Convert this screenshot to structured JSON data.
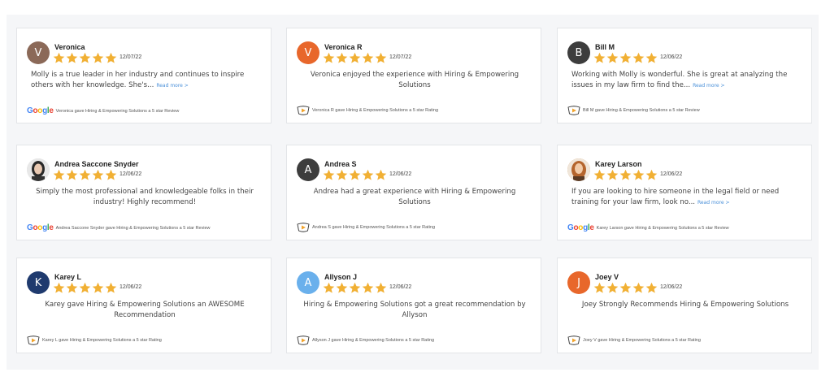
{
  "colors": {
    "star": "#f1b034",
    "link": "#4a90d9"
  },
  "reviews": [
    {
      "name": "Veronica",
      "date": "12/07/22",
      "initial": "V",
      "avatar_color": "#8b6958",
      "avatar_type": "initial",
      "text": "Molly is a true leader in her industry and continues to inspire others with her knowledge. She's...",
      "read_more": "Read more >",
      "centered": false,
      "source": "google",
      "footer": "Veronica gave Hiring & Empowering Solutions a 5 star Review",
      "stars": 5
    },
    {
      "name": "Veronica R",
      "date": "12/07/22",
      "initial": "V",
      "avatar_color": "#e8672b",
      "avatar_type": "initial",
      "text": "Veronica enjoyed the experience with Hiring & Empowering Solutions",
      "read_more": "",
      "centered": true,
      "source": "site",
      "footer": "Veronica R gave Hiring & Empowering Solutions a 5 star Rating",
      "stars": 5
    },
    {
      "name": "Bill M",
      "date": "12/06/22",
      "initial": "B",
      "avatar_color": "#3d3d3d",
      "avatar_type": "initial",
      "text": "Working with Molly is wonderful. She is great at analyzing the issues in my law firm to find the...",
      "read_more": "Read more >",
      "centered": false,
      "source": "site",
      "footer": "Bill M gave Hiring & Empowering Solutions a 5 star Review",
      "stars": 5
    },
    {
      "name": "Andrea Saccone Snyder",
      "date": "12/06/22",
      "initial": "",
      "avatar_color": "#d9d9d9",
      "avatar_type": "photo-dark",
      "text": "Simply the most professional and knowledgeable folks in their industry! Highly recommend!",
      "read_more": "",
      "centered": true,
      "source": "google",
      "footer": "Andrea Saccone Snyder gave Hiring & Empowering Solutions a 5 star Review",
      "stars": 5
    },
    {
      "name": "Andrea S",
      "date": "12/06/22",
      "initial": "A",
      "avatar_color": "#3d3d3d",
      "avatar_type": "initial",
      "text": "Andrea had a great experience with Hiring & Empowering Solutions",
      "read_more": "",
      "centered": true,
      "source": "site",
      "footer": "Andrea S gave Hiring & Empowering Solutions a 5 star Rating",
      "stars": 5
    },
    {
      "name": "Karey Larson",
      "date": "12/06/22",
      "initial": "",
      "avatar_color": "#c98a4a",
      "avatar_type": "photo-warm",
      "text": "If you are looking to hire someone in the legal field or need training for your law firm, look no...",
      "read_more": "Read more >",
      "centered": false,
      "source": "google",
      "footer": "Karey Larson gave Hiring & Empowering Solutions a 5 star Review",
      "stars": 5
    },
    {
      "name": "Karey L",
      "date": "12/06/22",
      "initial": "K",
      "avatar_color": "#1f3a6e",
      "avatar_type": "initial",
      "text": "Karey gave Hiring & Empowering Solutions an AWESOME Recommendation",
      "read_more": "",
      "centered": true,
      "source": "site",
      "footer": "Karey L gave Hiring & Empowering Solutions a 5 star Rating",
      "stars": 5
    },
    {
      "name": "Allyson J",
      "date": "12/06/22",
      "initial": "A",
      "avatar_color": "#6ab0ec",
      "avatar_type": "initial",
      "text": "Hiring & Empowering Solutions got a great recommendation by Allyson",
      "read_more": "",
      "centered": true,
      "source": "site",
      "footer": "Allyson J gave Hiring & Empowering Solutions a 5 star Rating",
      "stars": 5
    },
    {
      "name": "Joey V",
      "date": "12/06/22",
      "initial": "J",
      "avatar_color": "#e8672b",
      "avatar_type": "initial",
      "text": "Joey Strongly Recommends Hiring & Empowering Solutions",
      "read_more": "",
      "centered": true,
      "source": "site",
      "footer": "Joey V gave Hiring & Empowering Solutions a 5 star Rating",
      "stars": 5
    }
  ],
  "google_logo": {
    "letters": [
      "G",
      "o",
      "o",
      "g",
      "l",
      "e"
    ],
    "colors": [
      "#4285f4",
      "#ea4335",
      "#fbbc05",
      "#4285f4",
      "#34a853",
      "#ea4335"
    ]
  }
}
